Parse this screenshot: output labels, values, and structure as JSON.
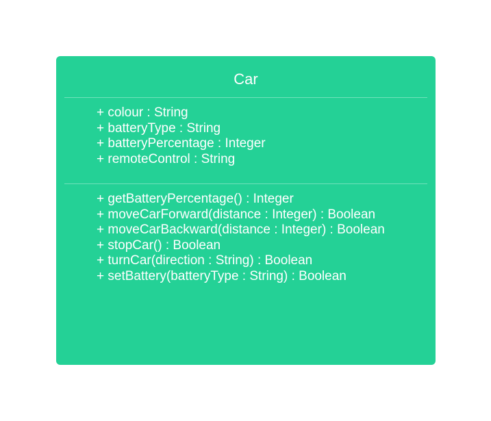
{
  "colors": {
    "class_fill": "#24D196",
    "text": "#FFFFFF",
    "background": "#FFFFFF"
  },
  "uml_class": {
    "name": "Car",
    "attributes": [
      "+ colour : String",
      "+ batteryType : String",
      "+ batteryPercentage : Integer",
      "+ remoteControl : String"
    ],
    "operations": [
      "+ getBatteryPercentage() : Integer",
      "+ moveCarForward(distance : Integer) : Boolean",
      "+ moveCarBackward(distance : Integer) : Boolean",
      "+ stopCar() : Boolean",
      "+ turnCar(direction : String) : Boolean",
      "+ setBattery(batteryType : String) : Boolean"
    ]
  }
}
